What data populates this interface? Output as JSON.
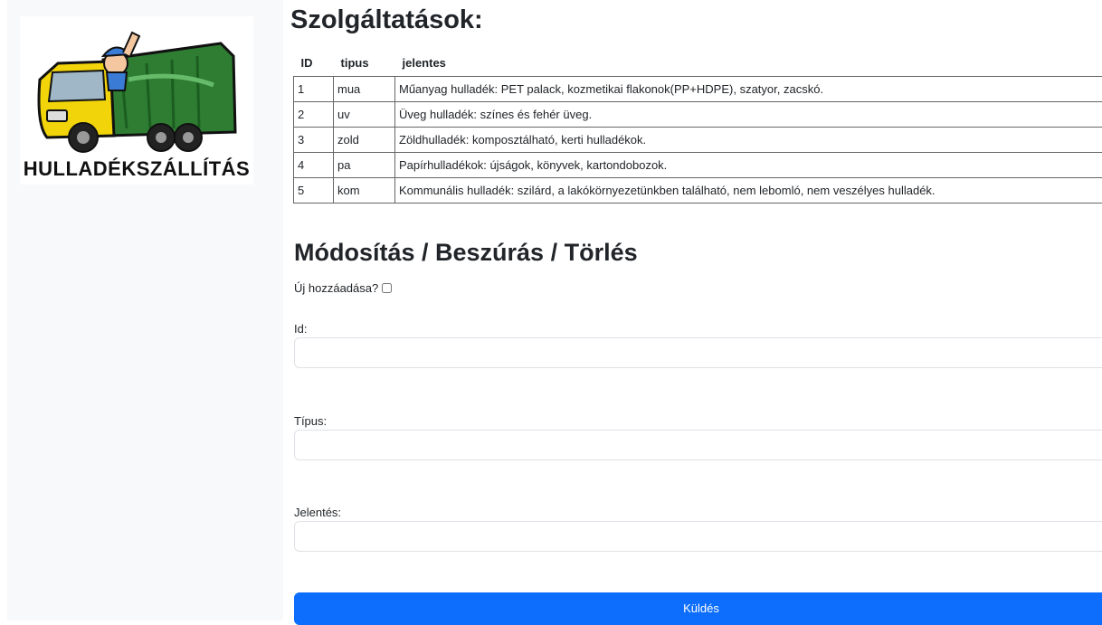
{
  "logo": {
    "text": "HULLADÉKSZÁLLÍTÁS",
    "icon": "garbage-truck-icon"
  },
  "services": {
    "title": "Szolgáltatások:",
    "headers": [
      "ID",
      "tipus",
      "jelentes"
    ],
    "rows": [
      [
        "1",
        "mua",
        "Műanyag hulladék: PET palack, kozmetikai flakonok(PP+HDPE), szatyor, zacskó."
      ],
      [
        "2",
        "uv",
        "Üveg hulladék: színes és fehér üveg."
      ],
      [
        "3",
        "zold",
        "Zöldhulladék: komposztálható, kerti hulladékok."
      ],
      [
        "4",
        "pa",
        "Papírhulladékok: újságok, könyvek, kartondobozok."
      ],
      [
        "5",
        "kom",
        "Kommunális hulladék: szilárd, a lakókörnyezetünkben található, nem lebomló, nem veszélyes hulladék."
      ]
    ]
  },
  "form": {
    "title": "Módosítás / Beszúrás / Törlés",
    "new_label": "Új hozzáadása?",
    "id_label": "Id:",
    "id_value": "",
    "tipus_label": "Típus:",
    "tipus_value": "",
    "jelentes_label": "Jelentés:",
    "jelentes_value": "",
    "submit_label": "Küldés"
  },
  "colors": {
    "primary": "#0d6efd",
    "sidebar_bg": "#f8f9fa",
    "truck_green": "#2e7d32",
    "truck_yellow": "#f2d40a"
  }
}
